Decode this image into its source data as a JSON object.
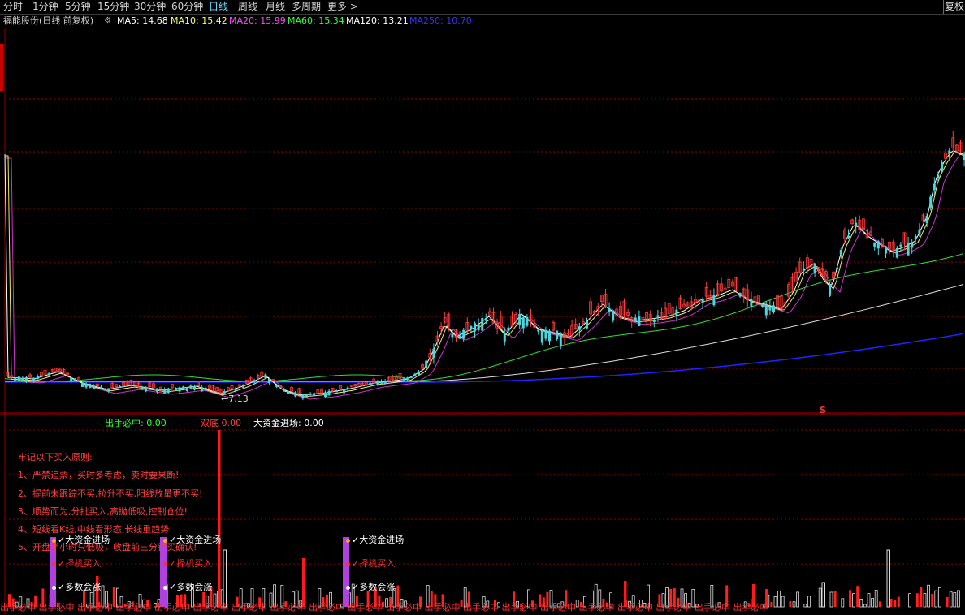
{
  "toolbar": {
    "timeframes": [
      "分时",
      "1分钟",
      "5分钟",
      "15分钟",
      "30分钟",
      "60分钟",
      "日线",
      "周线",
      "月线",
      "多周期",
      "更多 >"
    ],
    "active": "日线",
    "restore_label": "复权"
  },
  "info": {
    "stock": "福能股份(日线 前复权)",
    "ma5": "MA5: 14.68",
    "ma10": "MA10: 15.42",
    "ma20": "MA20: 15.99",
    "ma60": "MA60: 15.34",
    "ma120": "MA120: 13.21",
    "ma250": "MA250: 10.70",
    "colors": {
      "ma5": "#ffffff",
      "ma10": "#ffff66",
      "ma20": "#ff4dff",
      "ma60": "#33ff33",
      "ma120": "#ffffff",
      "ma250": "#3333ff"
    }
  },
  "chart": {
    "low_label": "7.13",
    "s_marker": "S"
  },
  "indicator": {
    "header_1": "出手必中: 0.00",
    "header_2_name": "双底",
    "header_2_value": "0.00",
    "header_3": "大资金进场: 0.00",
    "notes": [
      "牢记以下买入原则:",
      "1、严禁追票，买时多考虑，卖时要果断!",
      "2、提前未跟踪不买,拉升不买,阳线放量更不买!",
      "3、顺势而为,分批买入,高抛低吸,控制仓位!",
      "4、短线看K线,中线看形态,长线重趋势!",
      "5、开盘半小时只低吸，收盘前三分钟买确认!"
    ],
    "signals": [
      {
        "big": "✓大资金进场",
        "buy": "✓择机买入",
        "rise": "✓多数会涨"
      },
      {
        "big": "✓大资金进场",
        "buy": "✓择机买入",
        "rise": "✓多数会涨"
      },
      {
        "big": "✓大资金进场",
        "buy": "✓择机买入",
        "rise": "✓多数会涨"
      }
    ],
    "footer_text": "出手必中 出手必中 出手必中 出手必中 出手必中 出手必中 出手必中 出手必中 出手必中 出手必中 出手必中 出手必中 出手必中 出手必中 出手必中 出手必中 出手必中 出手必中 出手必中 出手必中"
  }
}
